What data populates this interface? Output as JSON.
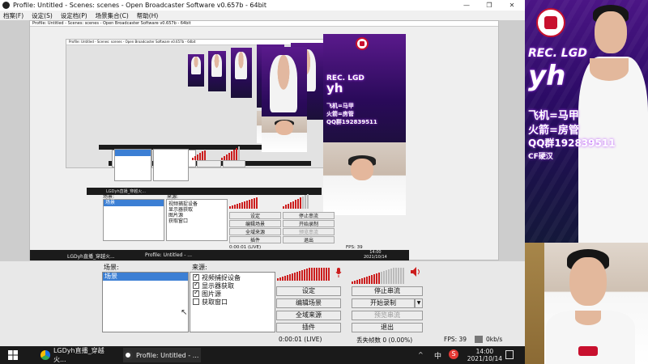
{
  "window": {
    "title": "Profile: Untitled - Scenes: scenes - Open Broadcaster Software v0.657b - 64bit",
    "minimize": "—",
    "maximize": "❐",
    "close": "✕"
  },
  "menu": [
    "档案(F)",
    "设定(S)",
    "设定档(P)",
    "场景集合(C)",
    "帮助(H)"
  ],
  "panels": {
    "scenes_label": "场景:",
    "sources_label": "来源:",
    "scenes": [
      "场景"
    ],
    "sources": [
      {
        "label": "视频捕捉设备",
        "checked": true
      },
      {
        "label": "显示器获取",
        "checked": true
      },
      {
        "label": "图片源",
        "checked": true
      },
      {
        "label": "获取窗口",
        "checked": false
      }
    ]
  },
  "buttons": {
    "settings": "设定",
    "stop_stream": "停止串流",
    "edit_scene": "编辑场景",
    "start_record": "开始录制",
    "global_sources": "全域来源",
    "preview_stream": "预览串流",
    "plugins": "插件",
    "exit": "退出",
    "dropdown_arrow": "▼"
  },
  "status": {
    "time": "0:00:01 (LIVE)",
    "dropped_frames": "丢失帧数  0 (0.00%)",
    "fps": "FPS: 39",
    "bitrate": "0kb/s"
  },
  "taskbar": {
    "items": [
      {
        "label": "LGDyh直播_穿越火..."
      },
      {
        "label": "Profile: Untitled - ..."
      }
    ],
    "ime": "中",
    "antivirus": "S",
    "time": "14:00",
    "date": "2021/10/14"
  },
  "nested_preview": {
    "title": "Profile: Untitled - Scenes: scenes - Open Broadcaster Software v0.657b - 64bit",
    "taskbar_items": [
      "LGDyh直播_穿越火...",
      "Profile: Untitled - ..."
    ],
    "time": "14:00",
    "date": "2021/10/14",
    "fps": "FPS: 39",
    "stream_time": "0:00:01 (LIVE)"
  },
  "overlay": {
    "team_tag": "REC. LGD",
    "player_name": "yh",
    "line1": "飞机=马甲",
    "line2": "火箭=房管",
    "line3": "QQ群192839511",
    "badge": "CF硬汉"
  },
  "colors": {
    "selection": "#3c7fd4",
    "meter_red": "#cc1d1d",
    "banner_purple": "#4b1585",
    "lgd_red": "#c8102e",
    "taskbar": "#1a1a1a"
  },
  "icons": [
    "obs-logo-icon",
    "mic-icon",
    "speaker-icon",
    "windows-start-icon",
    "chrome-icon",
    "obs-taskbar-icon",
    "notification-icon",
    "cursor-icon"
  ]
}
